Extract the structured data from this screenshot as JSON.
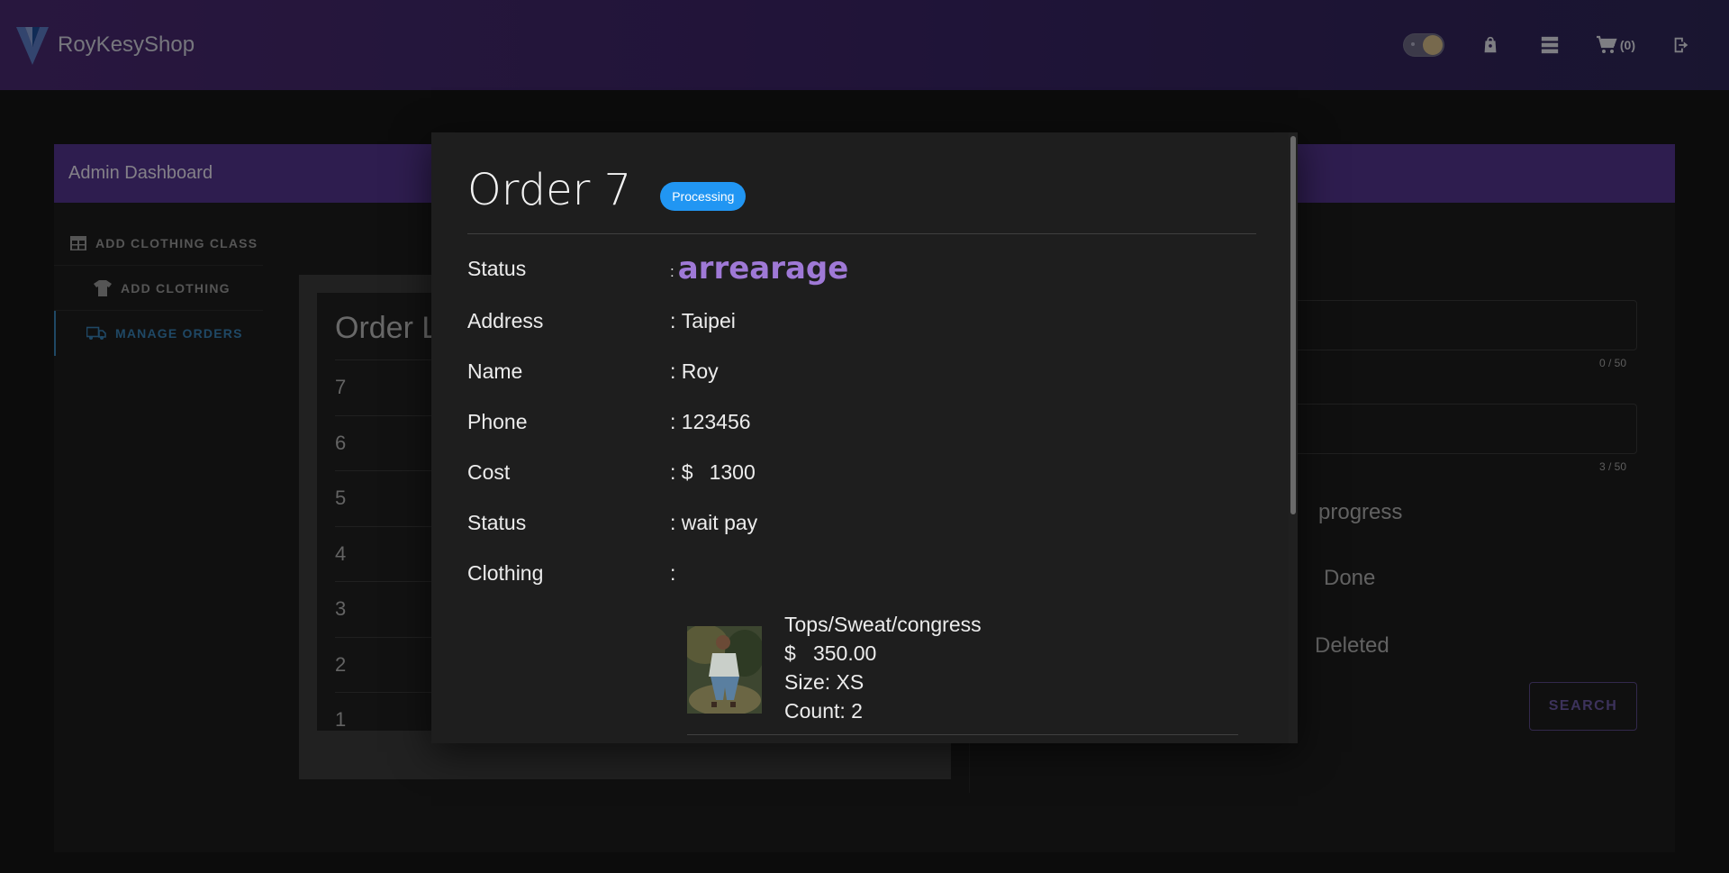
{
  "app": {
    "title": "RoyKesyShop",
    "cart_count": "(0)"
  },
  "dashboard": {
    "header": "Admin Dashboard",
    "nav": [
      {
        "label": "ADD CLOTHING CLASS",
        "icon": "table-icon"
      },
      {
        "label": "ADD CLOTHING",
        "icon": "tshirt-icon"
      },
      {
        "label": "MANAGE ORDERS",
        "icon": "truck-icon",
        "active": true
      }
    ],
    "orders_title": "Order L",
    "orders": [
      "7",
      "6",
      "5",
      "4",
      "3",
      "2",
      "1"
    ],
    "filters": {
      "counter_a": "0 / 50",
      "counter_b": "3 / 50",
      "radio_progress": "progress",
      "radio_done": "Done",
      "radio_deleted": "Deleted",
      "search_label": "SEARCH"
    }
  },
  "order_dialog": {
    "title": "Order 7",
    "chip": "Processing",
    "details": [
      {
        "label": "Status",
        "sep": ":",
        "value": "arrearage"
      },
      {
        "label": "Address",
        "sep": ": ",
        "value": "Taipei"
      },
      {
        "label": "Name",
        "sep": ": ",
        "value": "Roy"
      },
      {
        "label": "Phone",
        "sep": ": ",
        "value": "123456"
      },
      {
        "label": "Cost",
        "sep": ": ",
        "currency": "$",
        "value": "1300"
      },
      {
        "label": "Status",
        "sep": ": ",
        "value": "wait pay"
      },
      {
        "label": "Clothing",
        "sep": ":",
        "value": ""
      }
    ],
    "clothing": {
      "name": "Tops/Sweat/congress",
      "price": "$   350.00",
      "size": "Size: XS",
      "count": "Count: 2"
    }
  },
  "colors": {
    "appbar": "#4a2a72",
    "dashboard_header": "#553591",
    "accent": "#9f79d6",
    "chip": "#2196f3",
    "active_nav": "#3a83b8"
  }
}
